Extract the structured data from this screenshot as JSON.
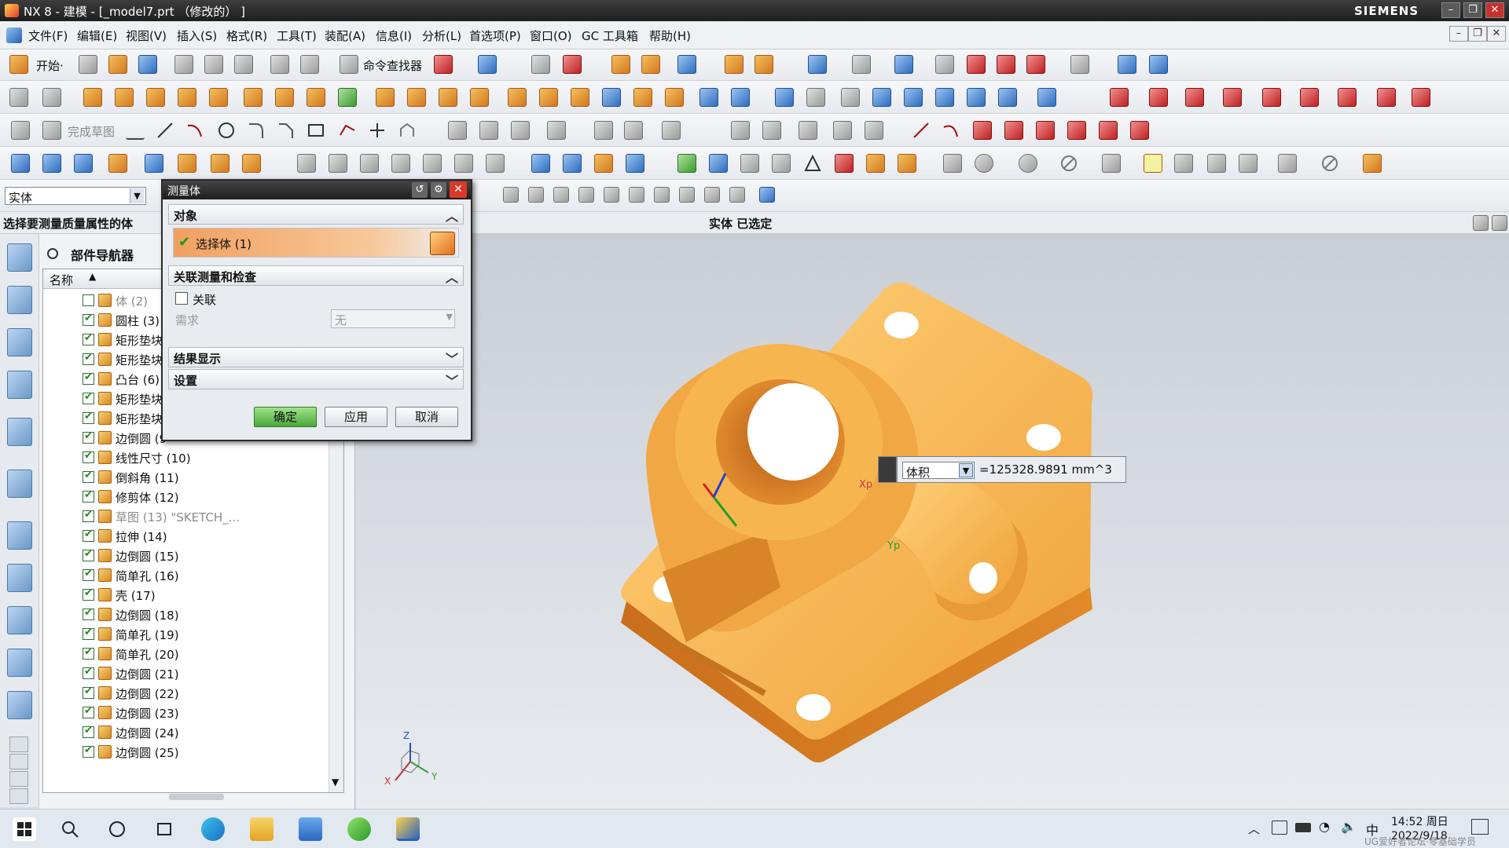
{
  "window": {
    "title": "NX 8 - 建模 - [_model7.prt （修改的） ]",
    "brand": "SIEMENS"
  },
  "menu": [
    "文件(F)",
    "编辑(E)",
    "视图(V)",
    "插入(S)",
    "格式(R)",
    "工具(T)",
    "装配(A)",
    "信息(I)",
    "分析(L)",
    "首选项(P)",
    "窗口(O)",
    "GC 工具箱",
    "帮助(H)"
  ],
  "toolbar": {
    "start_label": "开始·",
    "cmd_finder": "命令查找器",
    "finish_sketch": "完成草图"
  },
  "filter": {
    "value": "实体"
  },
  "status": {
    "prompt": "选择要测量质量属性的体",
    "selection": "实体 已选定"
  },
  "navigator": {
    "title": "部件导航器",
    "col_name": "名称",
    "items": [
      {
        "label": "体 (2)",
        "checked": false,
        "dim": true
      },
      {
        "label": "圆柱 (3)",
        "checked": true
      },
      {
        "label": "矩形垫块",
        "checked": true
      },
      {
        "label": "矩形垫块",
        "checked": true
      },
      {
        "label": "凸台 (6)",
        "checked": true
      },
      {
        "label": "矩形垫块",
        "checked": true
      },
      {
        "label": "矩形垫块",
        "checked": true
      },
      {
        "label": "边倒圆 (9",
        "checked": true
      },
      {
        "label": "线性尺寸 (10)",
        "checked": true
      },
      {
        "label": "倒斜角 (11)",
        "checked": true
      },
      {
        "label": "修剪体 (12)",
        "checked": true
      },
      {
        "label": "草图 (13) \"SKETCH_...",
        "checked": true,
        "dim": true
      },
      {
        "label": "拉伸 (14)",
        "checked": true
      },
      {
        "label": "边倒圆 (15)",
        "checked": true
      },
      {
        "label": "简单孔 (16)",
        "checked": true
      },
      {
        "label": "壳 (17)",
        "checked": true
      },
      {
        "label": "边倒圆 (18)",
        "checked": true
      },
      {
        "label": "简单孔 (19)",
        "checked": true
      },
      {
        "label": "简单孔 (20)",
        "checked": true
      },
      {
        "label": "边倒圆 (21)",
        "checked": true
      },
      {
        "label": "边倒圆 (22)",
        "checked": true
      },
      {
        "label": "边倒圆 (23)",
        "checked": true
      },
      {
        "label": "边倒圆 (24)",
        "checked": true
      },
      {
        "label": "边倒圆 (25)",
        "checked": true
      }
    ]
  },
  "dialog": {
    "title": "测量体",
    "sec_object": "对象",
    "select_body": "选择体 (1)",
    "sec_assoc": "关联测量和检查",
    "assoc_label": "关联",
    "requirement_label": "需求",
    "requirement_value": "无",
    "sec_result": "结果显示",
    "sec_settings": "设置",
    "ok": "确定",
    "apply": "应用",
    "cancel": "取消"
  },
  "measure": {
    "type": "体积",
    "value": "=125328.9891 mm^3"
  },
  "axes": {
    "xp": "Xp",
    "yp": "Yp",
    "x": "X",
    "y": "Y",
    "z": "Z"
  },
  "taskbar": {
    "time": "14:52 周日",
    "date": "2022/9/18",
    "ime": "中",
    "watermark": "UG爱好者论坛·零基础学员"
  },
  "colors": {
    "part": "#f5a843",
    "accent": "#e2572c"
  }
}
